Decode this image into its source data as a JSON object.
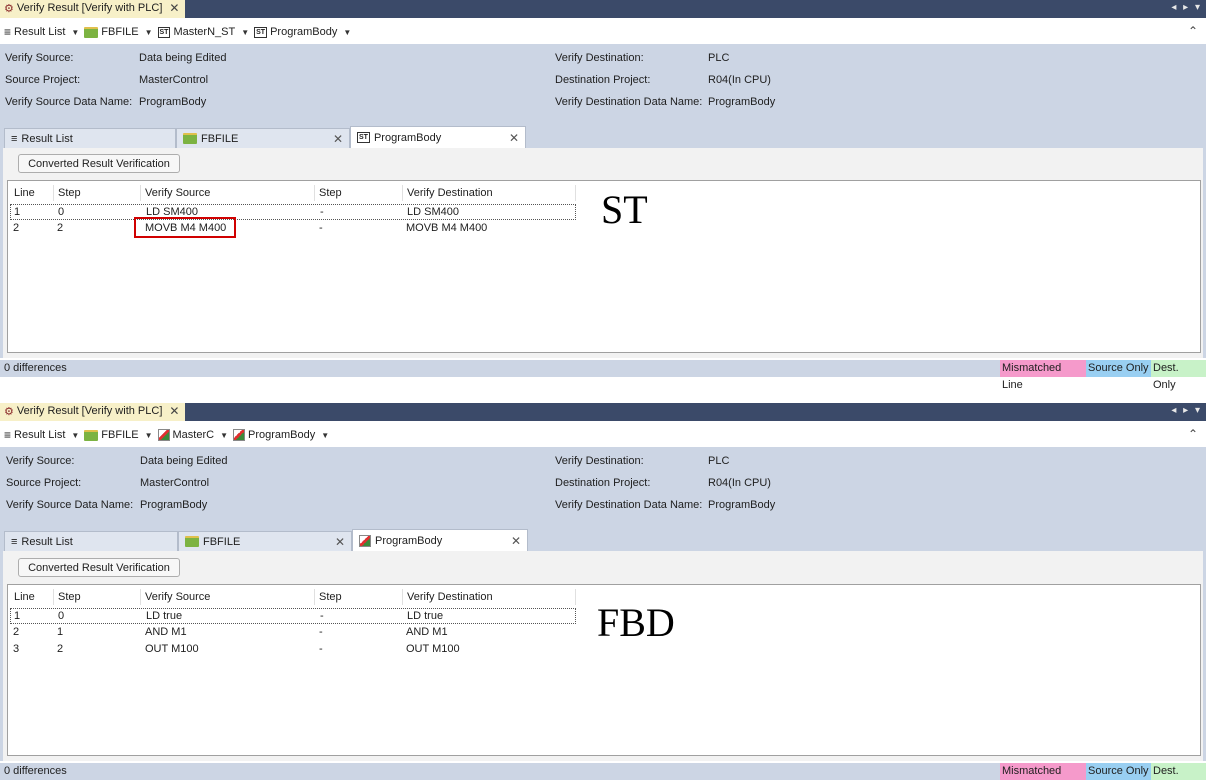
{
  "panels": [
    {
      "tab_title": "Verify Result [Verify with PLC]",
      "tab_close": "✕",
      "breadcrumb": {
        "result_list": "Result List",
        "fbfile": "FBFILE",
        "program": "MasterN_ST",
        "body": "ProgramBody"
      },
      "info": {
        "verify_source_label": "Verify Source:",
        "verify_source_value": "Data being Edited",
        "source_project_label": "Source Project:",
        "source_project_value": "MasterControl",
        "source_data_name_label": "Verify Source Data Name:",
        "source_data_name_value": "ProgramBody",
        "verify_dest_label": "Verify Destination:",
        "verify_dest_value": "PLC",
        "dest_project_label": "Destination Project:",
        "dest_project_value": "R04(In CPU)",
        "dest_data_name_label": "Verify Destination Data Name:",
        "dest_data_name_value": "ProgramBody"
      },
      "tabs": [
        "Result List",
        "FBFILE",
        "ProgramBody"
      ],
      "converted_button": "Converted Result Verification",
      "columns": [
        "Line",
        "Step",
        "Verify Source",
        "Step",
        "Verify Destination"
      ],
      "rows": [
        {
          "line": "1",
          "step": "0",
          "source": "LD SM400",
          "dstep": "-",
          "dest": "LD SM400"
        },
        {
          "line": "2",
          "step": "2",
          "source": "MOVB M4 M400",
          "dstep": "-",
          "dest": "MOVB M4 M400"
        }
      ],
      "highlighted_cell": "MOVB M4 M400",
      "overlay_label": "ST",
      "status": "0 differences",
      "legend": {
        "mismatched": "Mismatched Line",
        "source_only": "Source Only",
        "dest_only": "Dest. Only"
      }
    },
    {
      "tab_title": "Verify Result [Verify with PLC]",
      "tab_close": "✕",
      "breadcrumb": {
        "result_list": "Result List",
        "fbfile": "FBFILE",
        "program": "MasterC",
        "body": "ProgramBody"
      },
      "info": {
        "verify_source_label": "Verify Source:",
        "verify_source_value": "Data being Edited",
        "source_project_label": "Source Project:",
        "source_project_value": "MasterControl",
        "source_data_name_label": "Verify Source Data Name:",
        "source_data_name_value": "ProgramBody",
        "verify_dest_label": "Verify Destination:",
        "verify_dest_value": "PLC",
        "dest_project_label": "Destination Project:",
        "dest_project_value": "R04(In CPU)",
        "dest_data_name_label": "Verify Destination Data Name:",
        "dest_data_name_value": "ProgramBody"
      },
      "tabs": [
        "Result List",
        "FBFILE",
        "ProgramBody"
      ],
      "converted_button": "Converted Result Verification",
      "columns": [
        "Line",
        "Step",
        "Verify Source",
        "Step",
        "Verify Destination"
      ],
      "rows": [
        {
          "line": "1",
          "step": "0",
          "source": "LD true",
          "dstep": "-",
          "dest": "LD true"
        },
        {
          "line": "2",
          "step": "1",
          "source": "AND M1",
          "dstep": "-",
          "dest": "AND M1"
        },
        {
          "line": "3",
          "step": "2",
          "source": "OUT M100",
          "dstep": "-",
          "dest": "OUT M100"
        }
      ],
      "overlay_label": "FBD",
      "status": "0 differences",
      "legend": {
        "mismatched": "Mismatched Line",
        "source_only": "Source Only",
        "dest_only": "Dest. Only"
      }
    }
  ]
}
